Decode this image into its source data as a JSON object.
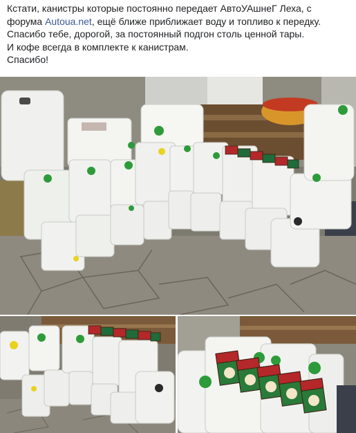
{
  "post": {
    "line1": "Кстати, канистры которые постоянно передает АвтоУАшнеГ Леха, с",
    "line2_before": "форума ",
    "line2_link": "Autoua.net",
    "line2_after": ", ещё ближе приближает воду и топливо к передку.",
    "line3": "Спасибо тебе, дорогой, за постоянный подгон столь ценной тары.",
    "line4": "И кофе всегда в комплекте к канистрам.",
    "line5": "Спасибо!"
  },
  "colors": {
    "link": "#385898",
    "text": "#1c1e21",
    "canister": "#f3f4f1",
    "cap_green": "#2e9b3a",
    "cap_yellow": "#e8d21f",
    "coffee_box": "#b4282a"
  },
  "photos": [
    {
      "name": "main",
      "subject": "white canisters on stone patio"
    },
    {
      "name": "bottom-left",
      "subject": "canisters row with coffee boxes"
    },
    {
      "name": "bottom-right",
      "subject": "coffee boxes on canisters close-up"
    }
  ]
}
